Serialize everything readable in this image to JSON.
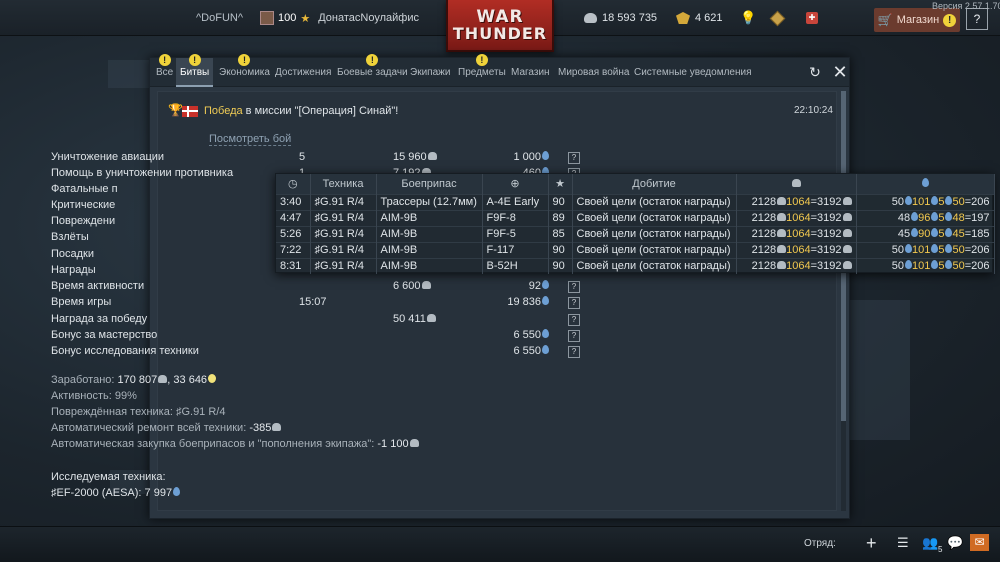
{
  "topbar": {
    "squad": "^DoFUN^",
    "level": "100",
    "nickname": "ДонатасNоулайфис",
    "logo_line1": "WAR",
    "logo_line2": "THUNDER",
    "silver_lions": "18 593 735",
    "golden_eagles": "4 621",
    "shop_label": "Магазин",
    "help_label": "?",
    "version": "Версия 2.57.1.70"
  },
  "tabs": [
    {
      "label": "Все",
      "badge": "!"
    },
    {
      "label": "Битвы",
      "badge": "!",
      "active": true
    },
    {
      "label": "Экономика",
      "badge": "!"
    },
    {
      "label": "Достижения",
      "badge": ""
    },
    {
      "label": "Боевые задачи",
      "badge": "!"
    },
    {
      "label": "Экипажи",
      "badge": ""
    },
    {
      "label": "Предметы",
      "badge": "!"
    },
    {
      "label": "Магазин",
      "badge": ""
    },
    {
      "label": "Мировая война",
      "badge": ""
    },
    {
      "label": "Системные уведомления",
      "badge": ""
    }
  ],
  "message": {
    "result": "Победа",
    "text": " в миссии \"[Операция] Синай\"!",
    "time": "22:10:24",
    "view_battle": "Посмотреть бой"
  },
  "rows": [
    {
      "label": "Уничтожение авиации",
      "count": "5",
      "lions": "15 960",
      "rp": "1 000"
    },
    {
      "label": "Помощь в уничтожении противника",
      "count": "1",
      "lions": "7 192",
      "rp": "460"
    },
    {
      "label": "Фатальные п",
      "count": "",
      "lions": "",
      "rp": ""
    },
    {
      "label": "Критические",
      "count": "",
      "lions": "",
      "rp": ""
    },
    {
      "label": "Повреждени",
      "count": "",
      "lions": "",
      "rp": ""
    },
    {
      "label": "Взлёты",
      "count": "",
      "lions": "",
      "rp": ""
    },
    {
      "label": "Посадки",
      "count": "",
      "lions": "",
      "rp": ""
    },
    {
      "label": "Награды",
      "count": "",
      "lions": "",
      "rp": ""
    },
    {
      "label": "Время активности",
      "count": "",
      "lions": "6 600",
      "rp": "92"
    },
    {
      "label": "Время игры",
      "count": "15:07",
      "lions": "",
      "rp": "19 836"
    },
    {
      "label": "Награда за победу",
      "count": "",
      "lions": "50 411",
      "rp": ""
    },
    {
      "label": "Бонус за мастерство",
      "count": "",
      "lions": "",
      "rp": "6 550"
    },
    {
      "label": "Бонус исследования техники",
      "count": "",
      "lions": "",
      "rp": "6 550"
    }
  ],
  "summary": {
    "earned_label": "Заработано: ",
    "earned_lions": "170 807",
    "earned_rp": "33 646",
    "activity_label": "Активность: ",
    "activity_value": "99%",
    "damaged_label": "Повреждённая техника: ",
    "damaged_value": "G.91 R/4",
    "repair_label": "Автоматический ремонт всей техники: ",
    "repair_value": "-385",
    "resupply_label": "Автоматическая закупка боеприпасов и \"пополнения экипажа\": ",
    "resupply_value": "-1 100",
    "research_label": "Исследуемая техника:",
    "research_vehicle": "EF-2000 (AESA)",
    "research_rp": "7 997"
  },
  "popup": {
    "headers": [
      "",
      "Техника",
      "Боеприпас",
      "",
      "★",
      "Добитие",
      "",
      ""
    ],
    "rows": [
      {
        "time": "3:40",
        "vehicle": "G.91 R/4",
        "weapon": "Трассеры (12.7мм)",
        "target": "A-4E Early",
        "bonus": "90",
        "type": "Своей цели (остаток награды)",
        "l_base": "2128",
        "l_mult": "1064",
        "l_total": "3192",
        "r_a": "50",
        "r_b": "101",
        "r_c": "5",
        "r_d": "50",
        "r_total": "206"
      },
      {
        "time": "4:47",
        "vehicle": "G.91 R/4",
        "weapon": "AIM-9B",
        "target": "F9F-8",
        "bonus": "89",
        "type": "Своей цели (остаток награды)",
        "l_base": "2128",
        "l_mult": "1064",
        "l_total": "3192",
        "r_a": "48",
        "r_b": "96",
        "r_c": "5",
        "r_d": "48",
        "r_total": "197"
      },
      {
        "time": "5:26",
        "vehicle": "G.91 R/4",
        "weapon": "AIM-9B",
        "target": "F9F-5",
        "bonus": "85",
        "type": "Своей цели (остаток награды)",
        "l_base": "2128",
        "l_mult": "1064",
        "l_total": "3192",
        "r_a": "45",
        "r_b": "90",
        "r_c": "5",
        "r_d": "45",
        "r_total": "185"
      },
      {
        "time": "7:22",
        "vehicle": "G.91 R/4",
        "weapon": "AIM-9B",
        "target": "F-117",
        "bonus": "90",
        "type": "Своей цели (остаток награды)",
        "l_base": "2128",
        "l_mult": "1064",
        "l_total": "3192",
        "r_a": "50",
        "r_b": "101",
        "r_c": "5",
        "r_d": "50",
        "r_total": "206"
      },
      {
        "time": "8:31",
        "vehicle": "G.91 R/4",
        "weapon": "AIM-9B",
        "target": "B-52H",
        "bonus": "90",
        "type": "Своей цели (остаток награды)",
        "l_base": "2128",
        "l_mult": "1064",
        "l_total": "3192",
        "r_a": "50",
        "r_b": "101",
        "r_c": "5",
        "r_d": "50",
        "r_total": "206"
      }
    ]
  },
  "bottombar": {
    "squad_label": "Отряд:",
    "friends_count": "5"
  },
  "colors": {
    "accent_gold": "#f0cc55",
    "rp_blue": "#6d9fd4",
    "shop_bg": "#6b3b2e",
    "mail_orange": "#d06b23",
    "logo_red": "#b12d24"
  },
  "icons": [
    "squad-icon",
    "silver-lions-icon",
    "golden-eagles-icon",
    "lightbulb-icon",
    "premium-icon",
    "gift-icon",
    "cart-icon",
    "warning-icon",
    "refresh-icon",
    "close-icon",
    "trophy-icon",
    "clock-icon",
    "crosshair-icon",
    "star-icon",
    "rp-icon",
    "plus-icon",
    "list-icon",
    "friends-icon",
    "chat-icon",
    "mail-icon"
  ]
}
